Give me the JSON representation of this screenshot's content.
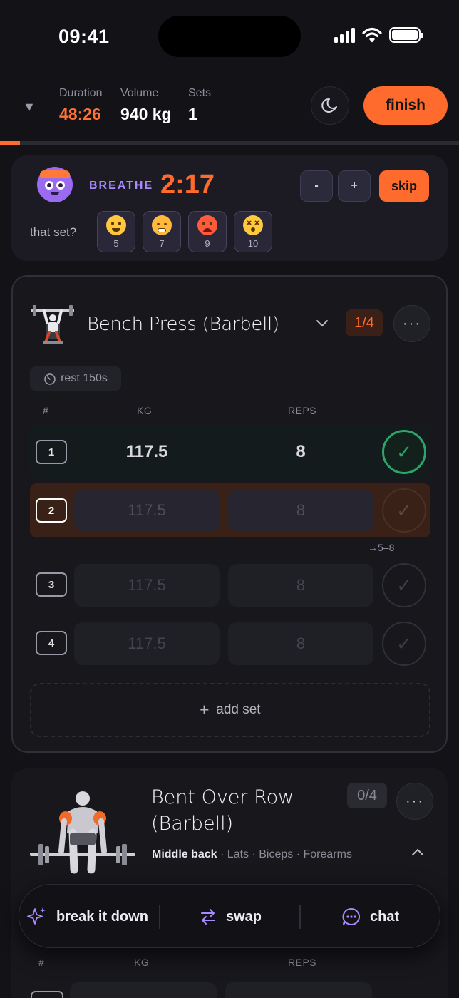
{
  "status_bar": {
    "time": "09:41"
  },
  "header": {
    "collapse_icon": "triangle-down-icon",
    "stats": [
      {
        "label": "Duration",
        "value": "48:26"
      },
      {
        "label": "Volume",
        "value": "940 kg"
      },
      {
        "label": "Sets",
        "value": "1"
      }
    ],
    "finish_label": "finish",
    "progress_fraction": 0.043,
    "accent_color": "#ff6b2c"
  },
  "rest": {
    "label": "BREATHE",
    "timer": "2:17",
    "minus_label": "-",
    "plus_label": "+",
    "skip_label": "skip",
    "prompt": "that set?",
    "rpe_options": [
      {
        "emoji": "smiling-face",
        "value": "5"
      },
      {
        "emoji": "steaming-face",
        "value": "7"
      },
      {
        "emoji": "hot-face",
        "value": "9"
      },
      {
        "emoji": "dizzy-face",
        "value": "10"
      }
    ]
  },
  "exercise1": {
    "name": "Bench Press (Barbell)",
    "set_counter": "1/4",
    "more_label": "···",
    "rest_label": "rest 150s",
    "columns": {
      "num": "#",
      "kg": "KG",
      "reps": "REPS"
    },
    "sets": [
      {
        "num": "1",
        "kg": "117.5",
        "reps": "8",
        "state": "done"
      },
      {
        "num": "2",
        "kg": "117.5",
        "reps": "8",
        "state": "active"
      },
      {
        "num": "3",
        "kg": "117.5",
        "reps": "8",
        "state": "pending"
      },
      {
        "num": "4",
        "kg": "117.5",
        "reps": "8",
        "state": "pending"
      }
    ],
    "target_hint": "→5–8",
    "add_set_label": "add set"
  },
  "exercise2": {
    "name_line1": "Bent Over Row",
    "name_line2": "(Barbell)",
    "set_counter": "0/4",
    "more_label": "···",
    "muscle_primary": "Middle back",
    "muscle_secondary": " · Lats · Biceps · Forearms",
    "columns": {
      "num": "#",
      "kg": "KG",
      "reps": "REPS"
    }
  },
  "actions": [
    {
      "label": "break it down",
      "icon": "sparkles-icon"
    },
    {
      "label": "swap",
      "icon": "swap-arrows-icon"
    },
    {
      "label": "chat",
      "icon": "chat-bubble-icon"
    }
  ]
}
